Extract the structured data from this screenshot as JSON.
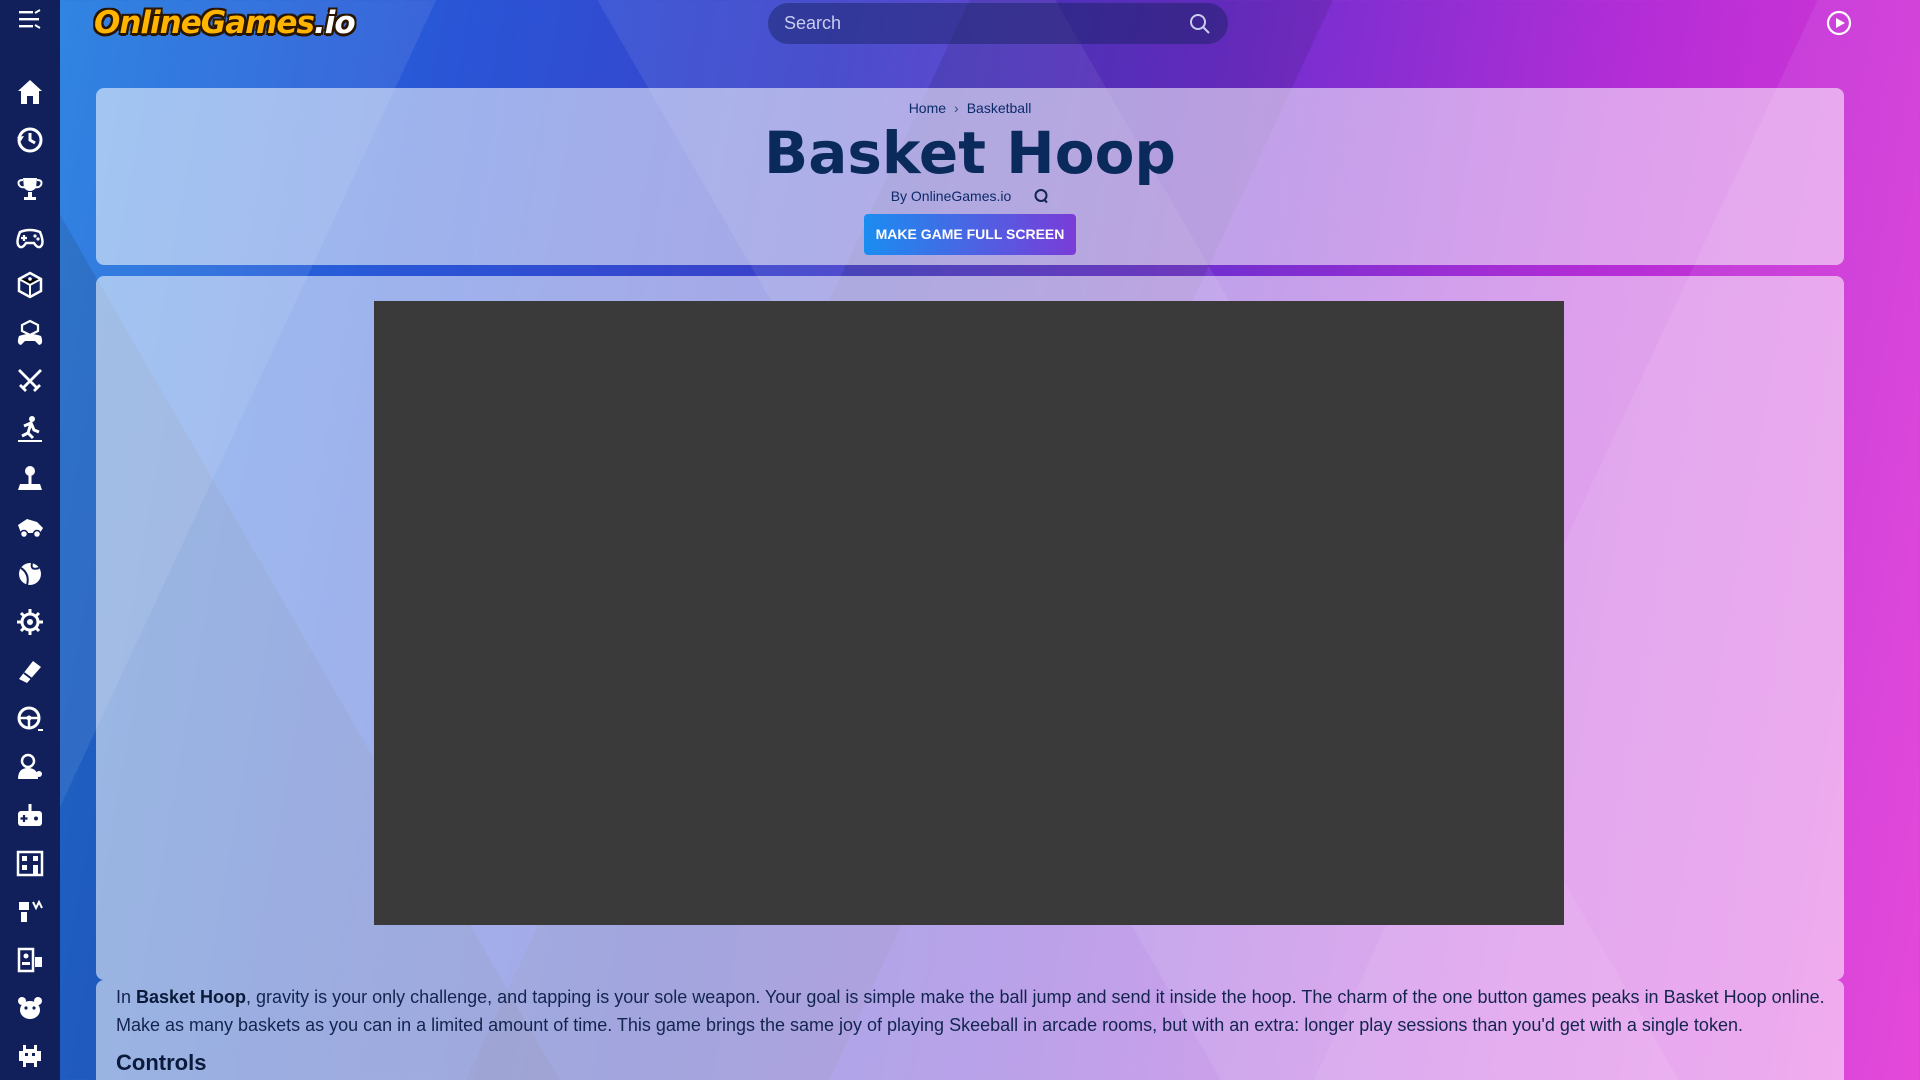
{
  "header": {
    "logo_main": "OnlineGames",
    "logo_suffix": ".io",
    "search_placeholder": "Search"
  },
  "sidebar": {
    "items": [
      {
        "icon": "home-icon"
      },
      {
        "icon": "history-icon"
      },
      {
        "icon": "trophy-icon"
      },
      {
        "icon": "gamepad-icon"
      },
      {
        "icon": "dice-icon"
      },
      {
        "icon": "puzzle-icon"
      },
      {
        "icon": "swords-icon"
      },
      {
        "icon": "runner-icon"
      },
      {
        "icon": "joystick-icon"
      },
      {
        "icon": "racing-icon"
      },
      {
        "icon": "sports-ball-icon"
      },
      {
        "icon": "settings-gear-icon"
      },
      {
        "icon": "shooting-icon"
      },
      {
        "icon": "steering-wheel-icon"
      },
      {
        "icon": "person-icon"
      },
      {
        "icon": "controller-icon"
      },
      {
        "icon": "building-icon"
      },
      {
        "icon": "blocks-icon"
      },
      {
        "icon": "robot-icon"
      },
      {
        "icon": "bear-icon"
      },
      {
        "icon": "space-invader-icon"
      }
    ]
  },
  "breadcrumb": {
    "home": "Home",
    "separator": "›",
    "category": "Basketball"
  },
  "game": {
    "title": "Basket Hoop",
    "byline": "By OnlineGames.io",
    "fullscreen_label": "MAKE GAME FULL SCREEN"
  },
  "description": {
    "intro_prefix": "In ",
    "intro_bold": "Basket Hoop",
    "intro_rest": ", gravity is your only challenge, and tapping is your sole weapon. Your goal is simple make the ball jump and send it inside the hoop. The charm of the one button games peaks in Basket Hoop online. Make as many baskets as you can in a limited amount of time. This game brings the same joy of playing Skeeball in arcade rooms, but with an extra: longer play sessions than you'd get with a single token.",
    "controls_heading": "Controls"
  },
  "colors": {
    "sidebar_bg": "#11205a",
    "title_color": "#0b2a5c",
    "button_gradient_start": "#1a8df0",
    "button_gradient_end": "#7a3cd8",
    "game_frame_bg": "#3a3a3a"
  }
}
